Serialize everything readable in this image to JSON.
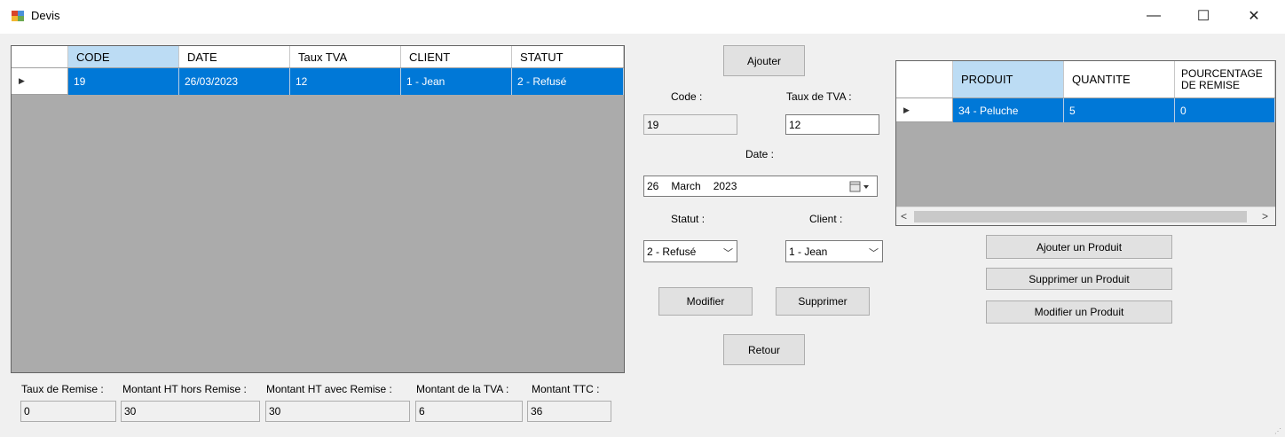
{
  "window": {
    "title": "Devis",
    "minimize": "—",
    "maximize": "☐",
    "close": "✕"
  },
  "devis_grid": {
    "columns": [
      "CODE",
      "DATE",
      "Taux TVA",
      "CLIENT",
      "STATUT"
    ],
    "rows": [
      [
        "19",
        "26/03/2023",
        "12",
        "1 - Jean",
        "2 - Refusé"
      ]
    ]
  },
  "form": {
    "add_button": "Ajouter",
    "code_label": "Code :",
    "code_value": "19",
    "tva_label": "Taux de TVA :",
    "tva_value": "12",
    "date_label": "Date :",
    "date_day": "26",
    "date_month": "March",
    "date_year": "2023",
    "statut_label": "Statut :",
    "statut_value": "2 - Refusé",
    "client_label": "Client :",
    "client_value": "1 - Jean",
    "modify_button": "Modifier",
    "delete_button": "Supprimer",
    "back_button": "Retour"
  },
  "product_grid": {
    "columns": [
      "PRODUIT",
      "QUANTITE",
      "POURCENTAGE DE REMISE"
    ],
    "rows": [
      [
        "34 - Peluche",
        "5",
        "0"
      ]
    ]
  },
  "product_buttons": {
    "add": "Ajouter un Produit",
    "delete": "Supprimer un Produit",
    "modify": "Modifier un Produit"
  },
  "totals": {
    "remise_label": "Taux de Remise :",
    "remise_value": "0",
    "ht_hors_label": "Montant HT hors Remise :",
    "ht_hors_value": "30",
    "ht_avec_label": "Montant HT avec Remise :",
    "ht_avec_value": "30",
    "tva_label": "Montant de la TVA :",
    "tva_value": "6",
    "ttc_label": "Montant TTC :",
    "ttc_value": "36"
  },
  "colors": {
    "selection": "#0078d7",
    "grid_background": "#ababab",
    "header_selected": "#bcdcf4"
  }
}
